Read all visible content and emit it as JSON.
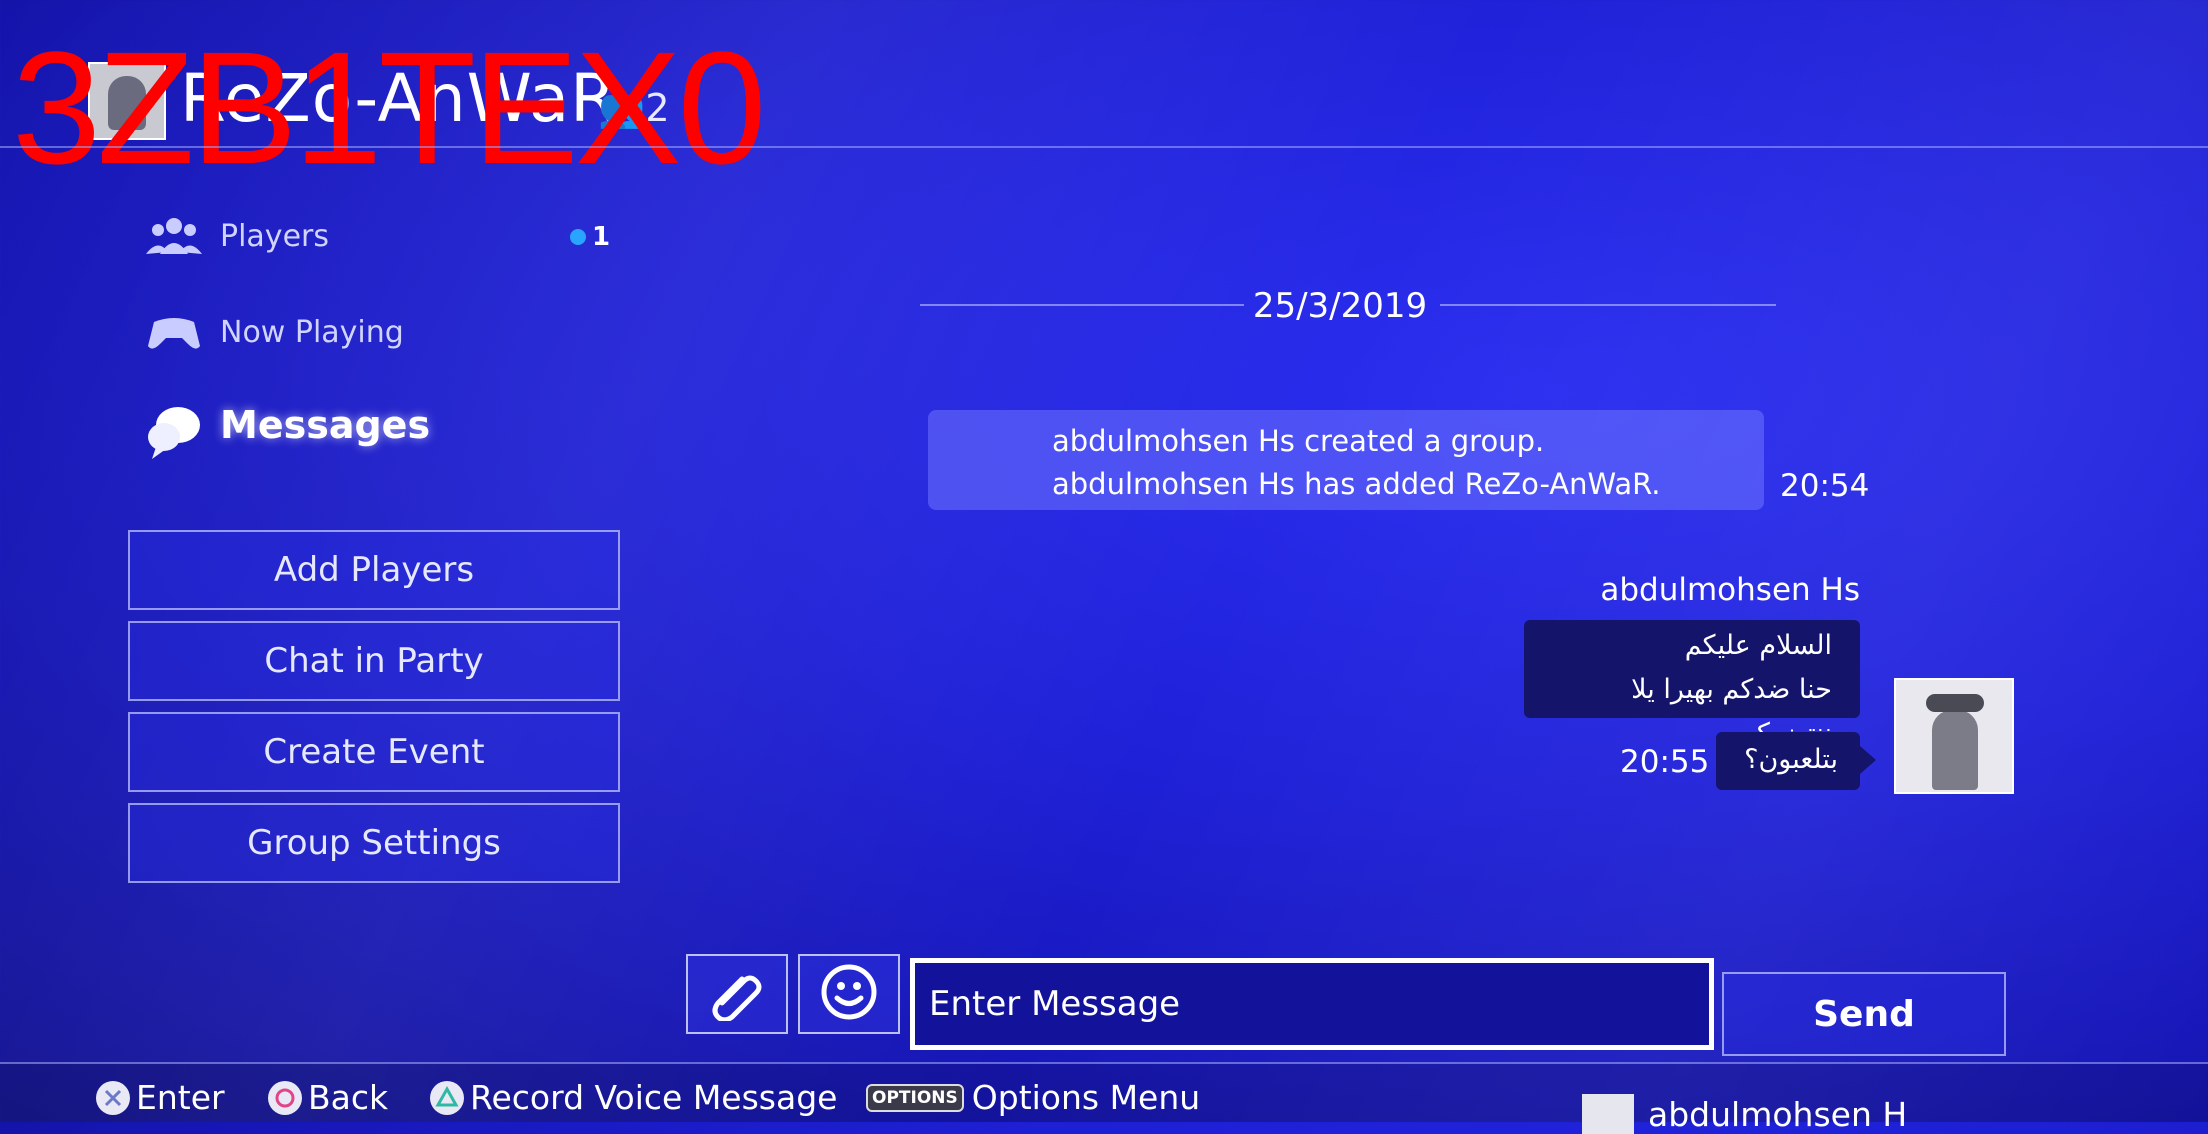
{
  "header": {
    "group_title": "ReZo-AnWaR",
    "member_count": "2",
    "watermark": "3ZB1TEX0"
  },
  "sidebar": {
    "nav": [
      {
        "label": "Players",
        "icon": "players-icon",
        "badge": "1"
      },
      {
        "label": "Now Playing",
        "icon": "controller-icon"
      },
      {
        "label": "Messages",
        "icon": "messages-icon",
        "active": true
      }
    ],
    "buttons": [
      {
        "label": "Add Players"
      },
      {
        "label": "Chat in Party"
      },
      {
        "label": "Create Event"
      },
      {
        "label": "Group Settings"
      }
    ]
  },
  "conversation": {
    "date": "25/3/2019",
    "system_message": {
      "lines": [
        "abdulmohsen Hs created a group.",
        "abdulmohsen Hs has added ReZo-AnWaR."
      ],
      "time": "20:54"
    },
    "messages": [
      {
        "sender": "abdulmohsen Hs",
        "bubbles": [
          {
            "lines": [
              "السلام عليكم",
              "حنا ضدكم بهيرا يلا ننتضركم"
            ]
          },
          {
            "lines": [
              "بتلعبون؟"
            ],
            "time": "20:55"
          }
        ]
      }
    ]
  },
  "composer": {
    "attach_icon": "paperclip-icon",
    "emoji_icon": "emoji-icon",
    "placeholder": "Enter Message",
    "send_label": "Send"
  },
  "footer": {
    "hints": [
      {
        "glyph": "cross-button-icon",
        "label": "Enter"
      },
      {
        "glyph": "circle-button-icon",
        "label": "Back"
      },
      {
        "glyph": "triangle-button-icon",
        "label": "Record Voice Message"
      },
      {
        "glyph": "options-button-icon",
        "key": "OPTIONS",
        "label": "Options Menu"
      }
    ],
    "user": "abdulmohsen H"
  },
  "colors": {
    "background": "#1f21d8",
    "badge_dot": "#2aa5ff",
    "bubble": "#14146a",
    "system_bubble": "#6e73ff",
    "watermark": "#ff0000"
  }
}
